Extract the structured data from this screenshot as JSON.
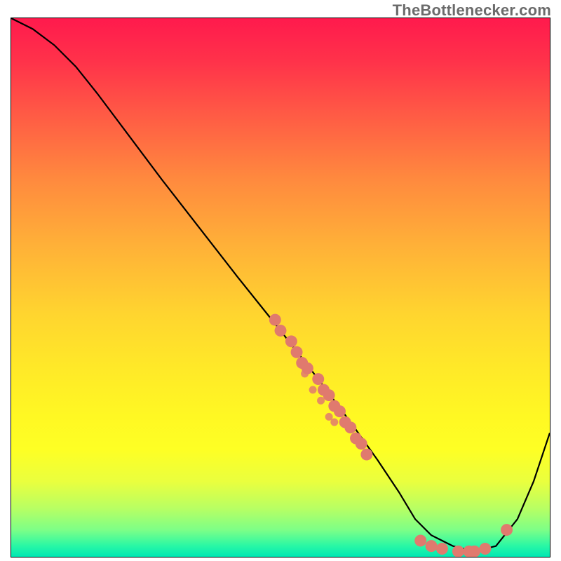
{
  "watermark": "TheBottlenecker.com",
  "colors": {
    "curve": "#000000",
    "point": "#e07a6e",
    "gradient_top": "#ff1a4d",
    "gradient_bottom": "#00e7b3"
  },
  "chart_data": {
    "type": "line",
    "title": "",
    "xlabel": "",
    "ylabel": "",
    "xlim": [
      0,
      100
    ],
    "ylim": [
      0,
      100
    ],
    "grid": false,
    "legend": false,
    "series": [
      {
        "name": "bottleneck-curve",
        "x": [
          0,
          4,
          8,
          12,
          16,
          22,
          28,
          35,
          42,
          50,
          57,
          63,
          68,
          72,
          75,
          78,
          82,
          86,
          90,
          94,
          97,
          100
        ],
        "y": [
          100,
          98,
          95,
          91,
          86,
          78,
          70,
          61,
          52,
          42,
          33,
          25,
          18,
          12,
          7,
          4,
          2,
          1,
          2,
          7,
          14,
          23
        ]
      }
    ],
    "points": [
      {
        "x": 49,
        "y": 44
      },
      {
        "x": 50,
        "y": 42
      },
      {
        "x": 52,
        "y": 40
      },
      {
        "x": 53,
        "y": 38
      },
      {
        "x": 54,
        "y": 36
      },
      {
        "x": 55,
        "y": 35
      },
      {
        "x": 57,
        "y": 33
      },
      {
        "x": 58,
        "y": 31
      },
      {
        "x": 59,
        "y": 30
      },
      {
        "x": 60,
        "y": 28
      },
      {
        "x": 61,
        "y": 27
      },
      {
        "x": 62,
        "y": 25
      },
      {
        "x": 63,
        "y": 24
      },
      {
        "x": 64,
        "y": 22
      },
      {
        "x": 65,
        "y": 21
      },
      {
        "x": 66,
        "y": 19
      },
      {
        "x": 76,
        "y": 3
      },
      {
        "x": 78,
        "y": 2
      },
      {
        "x": 80,
        "y": 1.5
      },
      {
        "x": 83,
        "y": 1
      },
      {
        "x": 85,
        "y": 1
      },
      {
        "x": 86,
        "y": 1
      },
      {
        "x": 88,
        "y": 1.5
      },
      {
        "x": 92,
        "y": 5
      }
    ],
    "secondary_points": [
      {
        "x": 54.5,
        "y": 34
      },
      {
        "x": 56,
        "y": 31
      },
      {
        "x": 57.5,
        "y": 29
      },
      {
        "x": 59,
        "y": 26
      },
      {
        "x": 60,
        "y": 25
      }
    ]
  }
}
